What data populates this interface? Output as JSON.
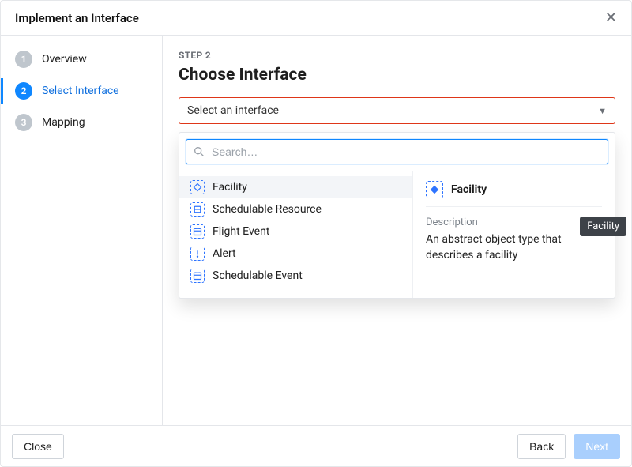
{
  "header": {
    "title": "Implement an Interface"
  },
  "sidebar": {
    "steps": [
      {
        "num": "1",
        "label": "Overview"
      },
      {
        "num": "2",
        "label": "Select Interface"
      },
      {
        "num": "3",
        "label": "Mapping"
      }
    ]
  },
  "main": {
    "eyebrow": "STEP 2",
    "heading": "Choose Interface",
    "select_placeholder": "Select an interface",
    "search_placeholder": "Search…",
    "options": [
      {
        "label": "Facility",
        "icon": "diamond"
      },
      {
        "label": "Schedulable Resource",
        "icon": "resource"
      },
      {
        "label": "Flight Event",
        "icon": "calendar"
      },
      {
        "label": "Alert",
        "icon": "alert"
      },
      {
        "label": "Schedulable Event",
        "icon": "calendar"
      }
    ],
    "detail": {
      "name": "Facility",
      "desc_label": "Description",
      "desc": "An abstract object type that describes a facility"
    },
    "tooltip": "Facility"
  },
  "footer": {
    "close": "Close",
    "back": "Back",
    "next": "Next"
  }
}
